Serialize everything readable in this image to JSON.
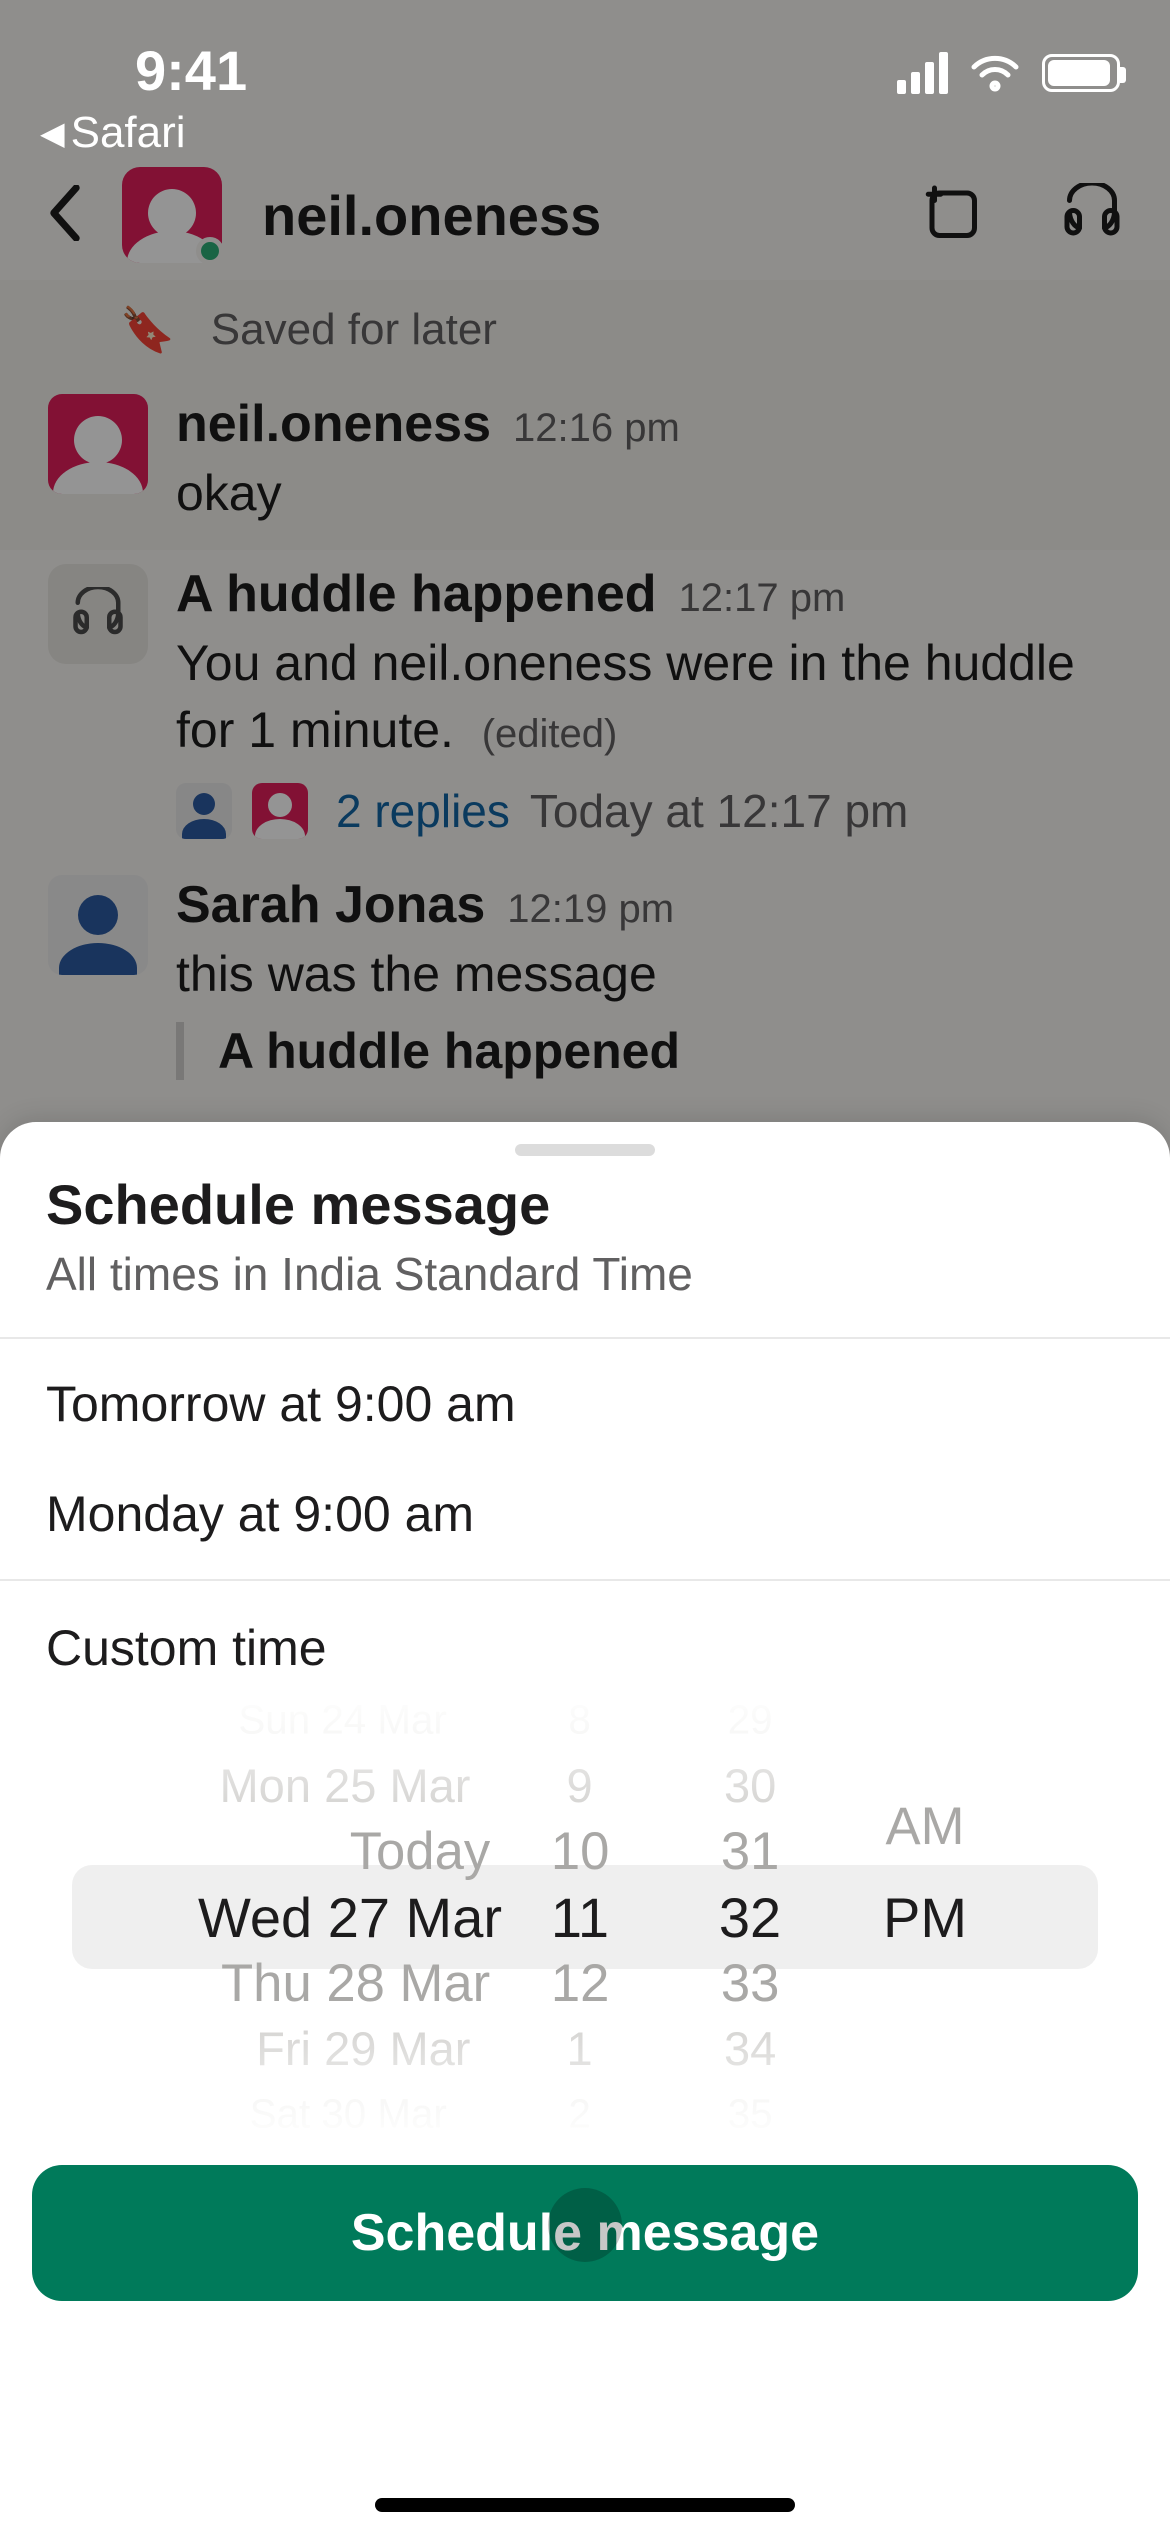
{
  "status_bar": {
    "time": "9:41",
    "back_app": "Safari"
  },
  "chat_header": {
    "title": "neil.oneness"
  },
  "saved_banner": "Saved for later",
  "messages": {
    "m1": {
      "sender": "neil.oneness",
      "time": "12:16 pm",
      "text": "okay"
    },
    "m2": {
      "title": "A huddle happened",
      "time": "12:17 pm",
      "text": "You and neil.oneness were in the huddle for 1 minute.",
      "edited": "(edited)",
      "replies_label": "2 replies",
      "replies_ts": "Today at 12:17 pm"
    },
    "m3": {
      "sender": "Sarah Jonas",
      "time": "12:19 pm",
      "text": "this was the message",
      "quoted": "A huddle happened"
    }
  },
  "sheet": {
    "title": "Schedule message",
    "subtitle": "All times in India Standard Time",
    "quick_options": {
      "opt1": "Tomorrow at 9:00 am",
      "opt2": "Monday at 9:00 am"
    },
    "custom_label": "Custom time",
    "picker": {
      "dates": {
        "d0": "Sun 24 Mar",
        "d1": "Mon 25 Mar",
        "d2": "Today",
        "d3": "Wed 27 Mar",
        "d4": "Thu 28 Mar",
        "d5": "Fri 29 Mar",
        "d6": "Sat 30 Mar"
      },
      "hours": {
        "h0": "8",
        "h1": "9",
        "h2": "10",
        "h3": "11",
        "h4": "12",
        "h5": "1",
        "h6": "2"
      },
      "minutes": {
        "m0": "29",
        "m1": "30",
        "m2": "31",
        "m3": "32",
        "m4": "33",
        "m5": "34",
        "m6": "35"
      },
      "ampm": {
        "a0": "AM",
        "a1": "PM"
      }
    },
    "button_label": "Schedule message"
  }
}
